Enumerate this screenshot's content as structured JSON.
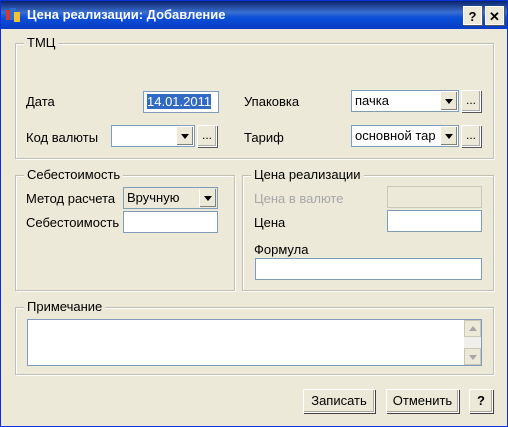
{
  "window": {
    "title": "Цена реализации: Добавление",
    "help_button": "?",
    "close_button": "✕"
  },
  "tmc": {
    "legend": "ТМЦ",
    "date_label": "Дата",
    "date_value": "14.01.2011",
    "currency_label": "Код валюты",
    "currency_value": "",
    "pack_label": "Упаковка",
    "pack_value": "пачка",
    "tariff_label": "Тариф",
    "tariff_value": "основной тар",
    "dots": "..."
  },
  "cost": {
    "legend": "Себестоимость",
    "method_label": "Метод расчета",
    "method_value": "Вручную",
    "cost_label": "Себестоимость",
    "cost_value": ""
  },
  "price": {
    "legend": "Цена реализации",
    "currency_price_label": "Цена в валюте",
    "currency_price_value": "",
    "price_label": "Цена",
    "price_value": "",
    "formula_label": "Формула",
    "formula_value": ""
  },
  "note": {
    "legend": "Примечание",
    "value": ""
  },
  "buttons": {
    "save": "Записать",
    "cancel": "Отменить",
    "help": "?"
  }
}
